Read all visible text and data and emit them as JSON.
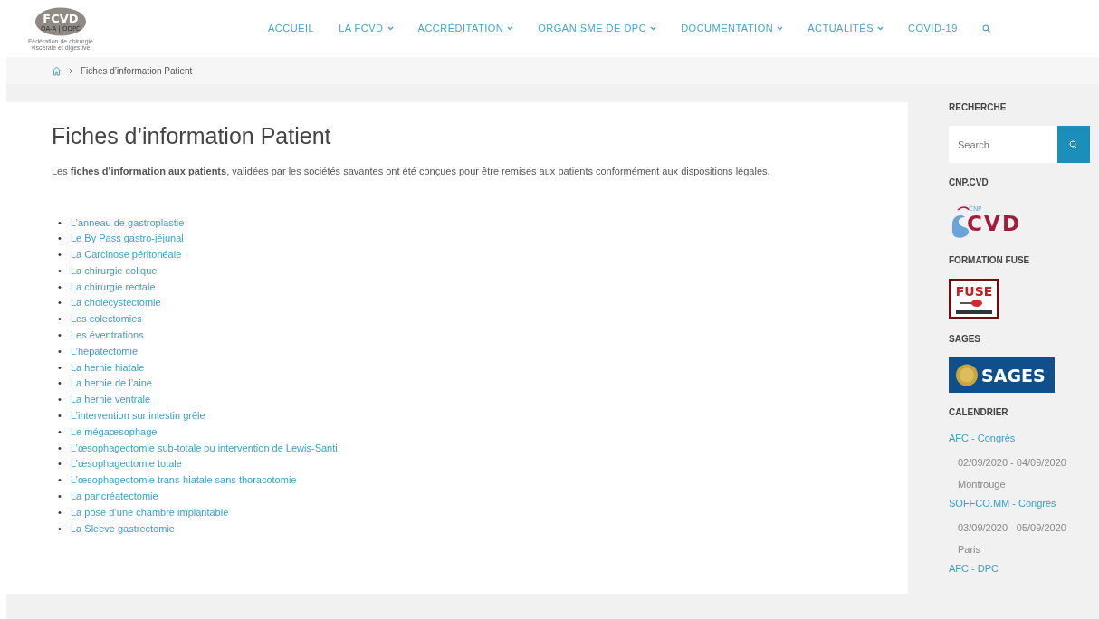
{
  "logo": {
    "name": "FCVD",
    "subtitle": "OA-A | ODPC",
    "caption": "Fédération de chirurgie viscérale et digestive"
  },
  "nav": [
    {
      "label": "ACCUEIL",
      "dropdown": false
    },
    {
      "label": "LA FCVD",
      "dropdown": true
    },
    {
      "label": "ACCRÉDITATION",
      "dropdown": true
    },
    {
      "label": "ORGANISME DE DPC",
      "dropdown": true
    },
    {
      "label": "DOCUMENTATION",
      "dropdown": true
    },
    {
      "label": "ACTUALITÉS",
      "dropdown": true
    },
    {
      "label": "COVID-19",
      "dropdown": false
    }
  ],
  "breadcrumb": {
    "current": "Fiches d’information Patient"
  },
  "page": {
    "bullet": "•",
    "title": "Fiches d’information Patient",
    "intro": "Les **fiches d’information aux patients**, validées par les sociétés savantes ont été conçues pour être remises aux patients conformément aux dispositions légales.",
    "links": [
      "L’anneau de gastroplastie",
      "Le By Pass gastro-jéjunal",
      "La Carcinose péritonéale",
      "La chirurgie colique",
      "La chirurgie rectale",
      "La cholecystectomie",
      "Les colectomies",
      "Les éventrations",
      "L’hépatectomie",
      "La hernie hiatale",
      "La hernie de l’aine",
      "La hernie ventrale",
      "L’intervention sur intestin grêle",
      "Le mégaœsophage",
      "L’œsophagectomie sub-totale ou intervention de Lewis-Santi",
      "L’œsophagectomie totale",
      "L’œsophagectomie trans-hiatale sans thoracotomie",
      "La pancréatectomie",
      "La pose d’une chambre implantable",
      "La Sleeve gastrectomie"
    ]
  },
  "sidebar": {
    "search": {
      "heading": "RECHERCHE",
      "placeholder": "Search"
    },
    "widgets": [
      {
        "heading": "CNP.CVD",
        "kind": "cnp",
        "logo_texts": [
          "CNP",
          "CVD"
        ]
      },
      {
        "heading": "FORMATION FUSE",
        "kind": "fuse",
        "logo_texts": [
          "FUSE"
        ]
      },
      {
        "heading": "SAGES",
        "kind": "sages",
        "logo_texts": [
          "SAGES"
        ]
      }
    ],
    "calendar": {
      "heading": "CALENDRIER",
      "events": [
        {
          "title": "AFC - Congrès",
          "dates": "02/09/2020 - 04/09/2020",
          "place": "Montrouge"
        },
        {
          "title": "SOFFCO.MM - Congrès",
          "dates": "03/09/2020 - 05/09/2020",
          "place": "Paris"
        },
        {
          "title": "AFC - DPC"
        }
      ]
    }
  }
}
